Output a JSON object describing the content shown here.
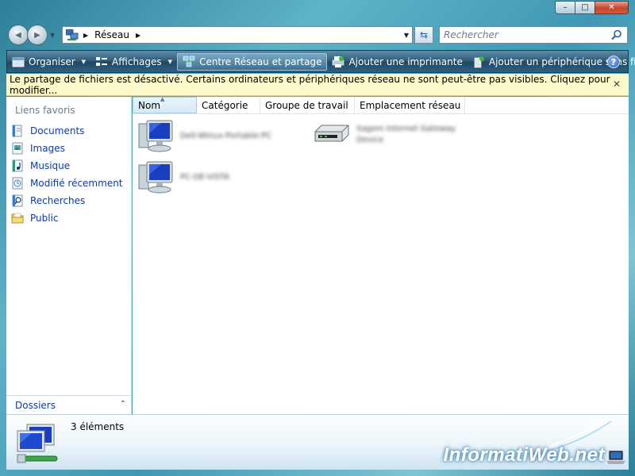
{
  "window": {
    "caption_buttons": [
      "–",
      "□",
      "✕"
    ]
  },
  "navigation": {
    "back_glyph": "◀",
    "forward_glyph": "▶",
    "dropdown_glyph": "▼"
  },
  "address": {
    "crumbs": [
      "Réseau"
    ],
    "sep_glyph": "▶",
    "drop_glyph": "▼",
    "icon": "network-icon"
  },
  "search": {
    "placeholder": "Rechercher",
    "icon": "magnifier-icon"
  },
  "toolbar": {
    "organiser": "Organiser",
    "affichages": "Affichages",
    "centre_reseau": "Centre Réseau et partage",
    "ajouter_imprimante": "Ajouter une imprimante",
    "ajouter_peripherique": "Ajouter un périphérique sans fil",
    "help": "?",
    "drop_glyph": "▼"
  },
  "infobar": {
    "message": "Le partage de fichiers est désactivé. Certains ordinateurs et périphériques réseau ne sont peut-être pas visibles. Cliquez pour modifier...",
    "close": "✕"
  },
  "sidebar": {
    "title": "Liens favoris",
    "items": [
      {
        "label": "Documents",
        "icon": "documents-icon"
      },
      {
        "label": "Images",
        "icon": "pictures-icon"
      },
      {
        "label": "Musique",
        "icon": "music-icon"
      },
      {
        "label": "Modifié récemment",
        "icon": "recent-icon"
      },
      {
        "label": "Recherches",
        "icon": "searches-icon"
      },
      {
        "label": "Public",
        "icon": "folder-icon"
      }
    ],
    "folders_label": "Dossiers",
    "folders_chevron": "⌃"
  },
  "columns": {
    "headers": [
      "Nom",
      "Catégorie",
      "Groupe de travail",
      "Emplacement réseau"
    ],
    "sort_glyph": "▲"
  },
  "items": [
    {
      "type": "computer",
      "name_line1": "Dell-Winux-Portable-PC",
      "name_line2": ""
    },
    {
      "type": "router",
      "name_line1": "Sagem Internet Gateway",
      "name_line2": "Device"
    },
    {
      "type": "computer",
      "name_line1": "PC-DE-VISTA",
      "name_line2": ""
    }
  ],
  "details": {
    "count": "3 éléments"
  },
  "watermark": "InformatiWeb.net",
  "colors": {
    "toolbar_top": "#5e8ca7",
    "toolbar_bottom": "#1f4864",
    "link": "#0e3aa5",
    "infobar_bg": "#fdf8c9"
  }
}
